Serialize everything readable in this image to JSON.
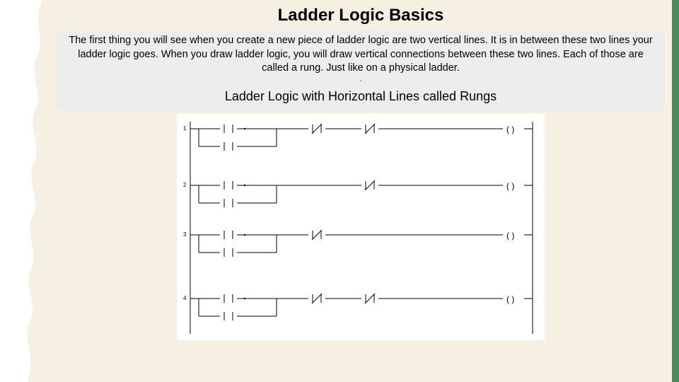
{
  "title": "Ladder Logic Basics",
  "body": "The first thing you will see when you create a new piece of ladder logic are two vertical lines. It is in between these two lines your ladder logic goes. When you draw ladder logic, you will draw vertical connections between these two lines. Each of those are called a rung. Just like on a physical ladder.",
  "dash": "-",
  "subtitle": "Ladder Logic with Horizontal Lines called Rungs",
  "rung_labels": [
    "1",
    "2",
    "3",
    "4"
  ],
  "colors": {
    "background": "#f5f0e1",
    "accent": "#4a8b5c",
    "text_block": "#ededed"
  }
}
